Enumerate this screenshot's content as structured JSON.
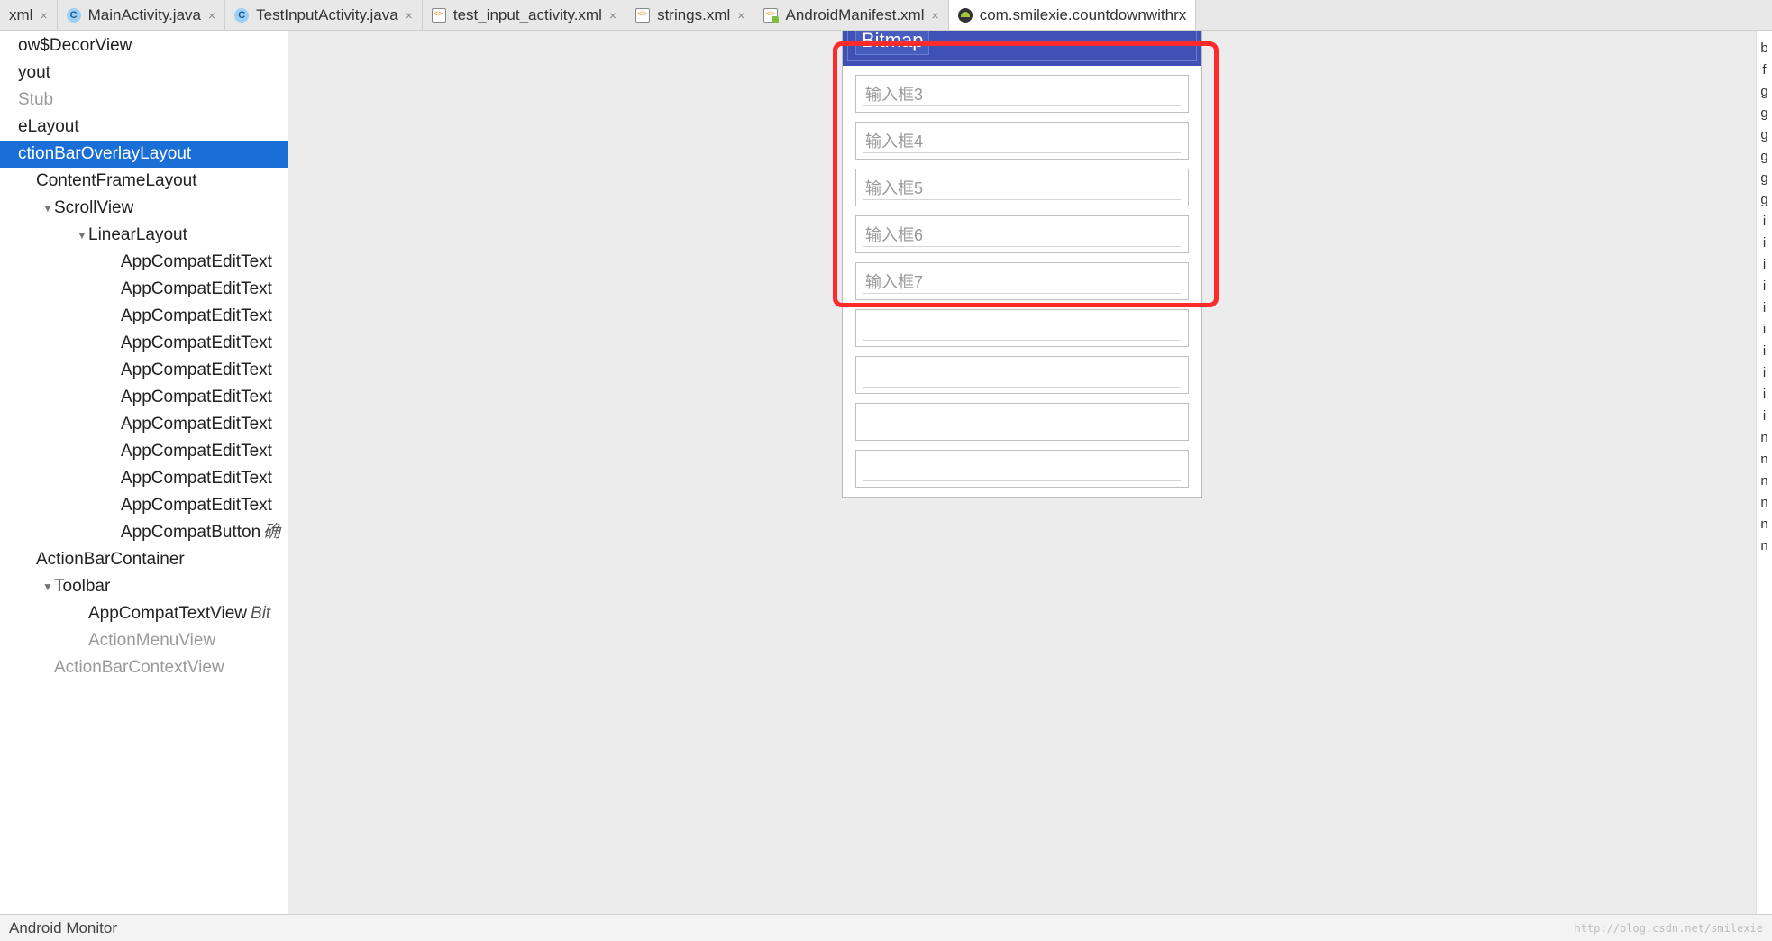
{
  "tabs": [
    {
      "label": "xml",
      "type": "xml-bare",
      "closable": true
    },
    {
      "label": "MainActivity.java",
      "type": "java",
      "closable": true
    },
    {
      "label": "TestInputActivity.java",
      "type": "java",
      "closable": true
    },
    {
      "label": "test_input_activity.xml",
      "type": "xml",
      "closable": true
    },
    {
      "label": "strings.xml",
      "type": "xml",
      "closable": true
    },
    {
      "label": "AndroidManifest.xml",
      "type": "xml-manifest",
      "closable": true
    },
    {
      "label": "com.smilexie.countdownwithrx",
      "type": "android",
      "closable": false,
      "active": true
    }
  ],
  "tree": {
    "rows": [
      {
        "name": "ow$DecorView",
        "indent": 0
      },
      {
        "name": "yout",
        "indent": 0
      },
      {
        "name": "Stub",
        "indent": 0,
        "dim": true
      },
      {
        "name": "eLayout",
        "indent": 0
      },
      {
        "name": "ctionBarOverlayLayout",
        "indent": 0,
        "selected": true
      },
      {
        "name": "ContentFrameLayout",
        "indent": 1
      },
      {
        "name": "ScrollView",
        "indent": 2,
        "expander": "▼"
      },
      {
        "name": "LinearLayout",
        "indent": 3,
        "expander": "▼"
      },
      {
        "name": "AppCompatEditText",
        "indent": 4
      },
      {
        "name": "AppCompatEditText",
        "indent": 4
      },
      {
        "name": "AppCompatEditText",
        "indent": 4
      },
      {
        "name": "AppCompatEditText",
        "indent": 4
      },
      {
        "name": "AppCompatEditText",
        "indent": 4
      },
      {
        "name": "AppCompatEditText",
        "indent": 4
      },
      {
        "name": "AppCompatEditText",
        "indent": 4
      },
      {
        "name": "AppCompatEditText",
        "indent": 4
      },
      {
        "name": "AppCompatEditText",
        "indent": 4
      },
      {
        "name": "AppCompatEditText",
        "indent": 4
      },
      {
        "name": "AppCompatButton",
        "indent": 4,
        "extra": "确"
      },
      {
        "name": "ActionBarContainer",
        "indent": 1
      },
      {
        "name": "Toolbar",
        "indent": 2,
        "expander": "▼"
      },
      {
        "name": "AppCompatTextView",
        "indent": 3,
        "extra": "Bit"
      },
      {
        "name": "ActionMenuView",
        "indent": 3,
        "dim": true
      },
      {
        "name": "ActionBarContextView",
        "indent": 2,
        "dim": true
      }
    ]
  },
  "preview": {
    "title": "Bitmap",
    "fields": [
      "输入框3",
      "输入框4",
      "输入框5",
      "输入框6",
      "输入框7"
    ],
    "empty_field_count": 4,
    "highlight_field_count": 5
  },
  "rightstrip": [
    "b",
    "f",
    "g",
    "g",
    "g",
    "g",
    "g",
    "g",
    "i",
    "i",
    "i",
    "i",
    "i",
    "i",
    "i",
    "i",
    "i",
    "i",
    "n",
    "n",
    "n",
    "n",
    "n",
    "n"
  ],
  "status": {
    "left": "Android Monitor",
    "right": "http://blog.csdn.net/smilexie"
  }
}
